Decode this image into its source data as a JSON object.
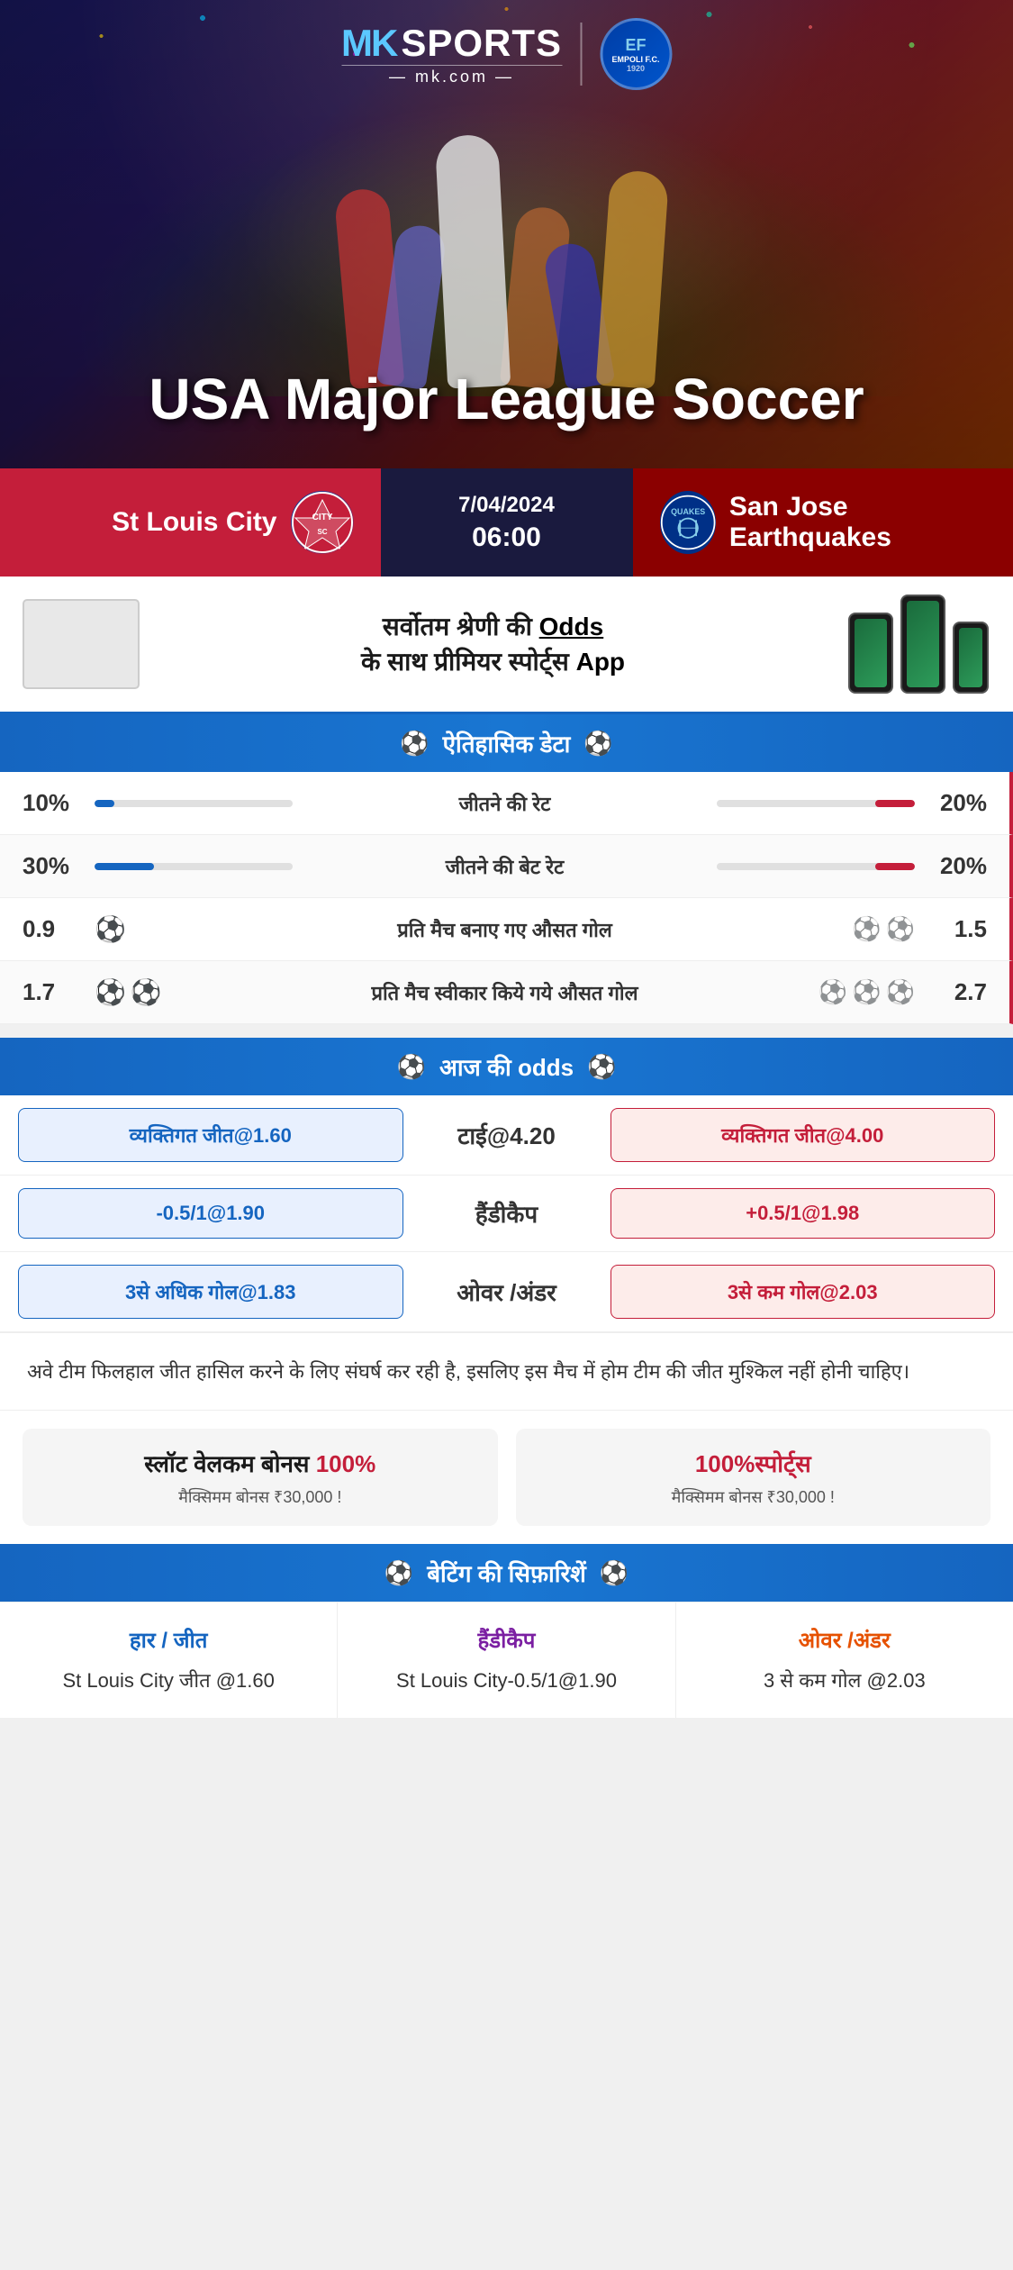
{
  "header": {
    "brand": "MK",
    "sports": "SPORTS",
    "domain": "— mk.com —",
    "empoli": {
      "ef": "EF",
      "fc": "EMPOLI F.C.",
      "year": "1920"
    },
    "title": "USA Major League Soccer"
  },
  "match": {
    "home_team": "St Louis City",
    "away_team": "San Jose Earthquakes",
    "date": "7/04/2024",
    "time": "06:00"
  },
  "promo": {
    "text_line1": "सर्वोतम श्रेणी की",
    "odds_bold": "Odds",
    "text_line2": "के साथ प्रीमियर स्पोर्ट्स",
    "app_bold": "App"
  },
  "historical": {
    "header": "ऐतिहासिक डेटा",
    "stats": [
      {
        "label": "जीतने की रेट",
        "left_val": "10%",
        "right_val": "20%",
        "left_pct": 10,
        "right_pct": 20
      },
      {
        "label": "जीतने की बेट रेट",
        "left_val": "30%",
        "right_val": "20%",
        "left_pct": 30,
        "right_pct": 20
      },
      {
        "label": "प्रति मैच बनाए गए औसत गोल",
        "left_val": "0.9",
        "right_val": "1.5",
        "left_balls": 1,
        "right_balls": 2
      },
      {
        "label": "प्रति मैच स्वीकार किये गये औसत गोल",
        "left_val": "1.7",
        "right_val": "2.7",
        "left_balls": 2,
        "right_balls": 3
      }
    ]
  },
  "odds": {
    "header": "आज की odds",
    "rows": [
      {
        "left_btn": "व्यक्तिगत जीत@1.60",
        "center_label": "टाई@4.20",
        "right_btn": "व्यक्तिगत जीत@4.00"
      },
      {
        "left_btn": "-0.5/1@1.90",
        "center_label": "हैंडीकैप",
        "right_btn": "+0.5/1@1.98"
      },
      {
        "left_btn": "3से अधिक गोल@1.83",
        "center_label": "ओवर /अंडर",
        "right_btn": "3से कम गोल@2.03"
      }
    ]
  },
  "analysis": "अवे टीम फिलहाल जीत हासिल करने के लिए संघर्ष कर रही है, इसलिए इस मैच में होम टीम की जीत मुश्किल नहीं होनी चाहिए।",
  "bonus": [
    {
      "title": "स्लॉट वेलकम बोनस",
      "percent": "100%",
      "subtitle": "मैक्सिमम बोनस ₹30,000 !"
    },
    {
      "title": "100%",
      "sports_text": "स्पोर्ट्स",
      "subtitle": "मैक्सिमम बोनस  ₹30,000 !"
    }
  ],
  "betting_rec": {
    "header": "बेटिंग की सिफ़ारिशें",
    "cols": [
      {
        "title": "हार / जीत",
        "value": "St Louis City जीत @1.60",
        "color": "blue"
      },
      {
        "title": "हैंडीकैप",
        "value": "St Louis City-0.5/1@1.90",
        "color": "purple"
      },
      {
        "title": "ओवर /अंडर",
        "value": "3 से कम गोल @2.03",
        "color": "orange"
      }
    ]
  }
}
